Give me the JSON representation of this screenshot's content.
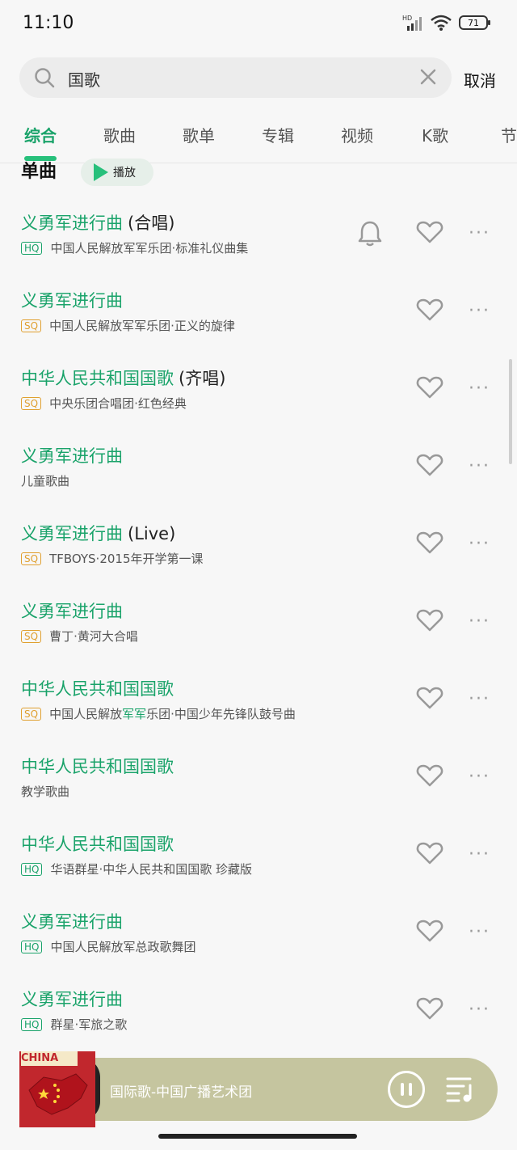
{
  "status": {
    "time": "11:10",
    "battery": "71"
  },
  "search": {
    "query": "国歌",
    "cancel_label": "取消"
  },
  "tabs": [
    "综合",
    "歌曲",
    "歌单",
    "专辑",
    "视频",
    "K歌",
    "节"
  ],
  "section": {
    "title": "单曲",
    "play_label": "播放"
  },
  "songs": [
    {
      "title": "义勇军进行曲",
      "extra": "(合唱)",
      "badge": "HQ",
      "meta": "中国人民解放军军乐团·标准礼仪曲集",
      "bell": true
    },
    {
      "title": "义勇军进行曲",
      "extra": "",
      "badge": "SQ",
      "meta": "中国人民解放军军乐团·正义的旋律"
    },
    {
      "title": "中华人民共和国国歌",
      "extra": "(齐唱)",
      "badge": "SQ",
      "meta": "中央乐团合唱团·红色经典"
    },
    {
      "title": "义勇军进行曲",
      "extra": "",
      "badge": "",
      "meta": "儿童歌曲"
    },
    {
      "title": "义勇军进行曲",
      "extra": "(Live)",
      "badge": "SQ",
      "meta": "TFBOYS·2015年开学第一课"
    },
    {
      "title": "义勇军进行曲",
      "extra": "",
      "badge": "SQ",
      "meta": "曹丁·黄河大合唱"
    },
    {
      "title": "中华人民共和国国歌",
      "extra": "",
      "badge": "SQ",
      "meta_pre": "中国人民解放",
      "meta_hl": "军军",
      "meta_post": "乐团·中国少年先锋队鼓号曲"
    },
    {
      "title": "中华人民共和国国歌",
      "extra": "",
      "badge": "",
      "meta": "教学歌曲"
    },
    {
      "title": "中华人民共和国国歌",
      "extra": "",
      "badge": "HQ",
      "meta": "华语群星·中华人民共和国国歌 珍藏版"
    },
    {
      "title": "义勇军进行曲",
      "extra": "",
      "badge": "HQ",
      "meta": "中国人民解放军总政歌舞团"
    },
    {
      "title": "义勇军进行曲",
      "extra": "",
      "badge": "HQ",
      "meta": "群星·军旅之歌"
    }
  ],
  "player": {
    "cover_text": "CHINA",
    "now_playing": "国际歌-中国广播艺术团"
  },
  "colors": {
    "accent": "#1aa36a",
    "hq": "#1aa36a",
    "sq": "#e0a030",
    "player_bg": "#c5c59f"
  }
}
